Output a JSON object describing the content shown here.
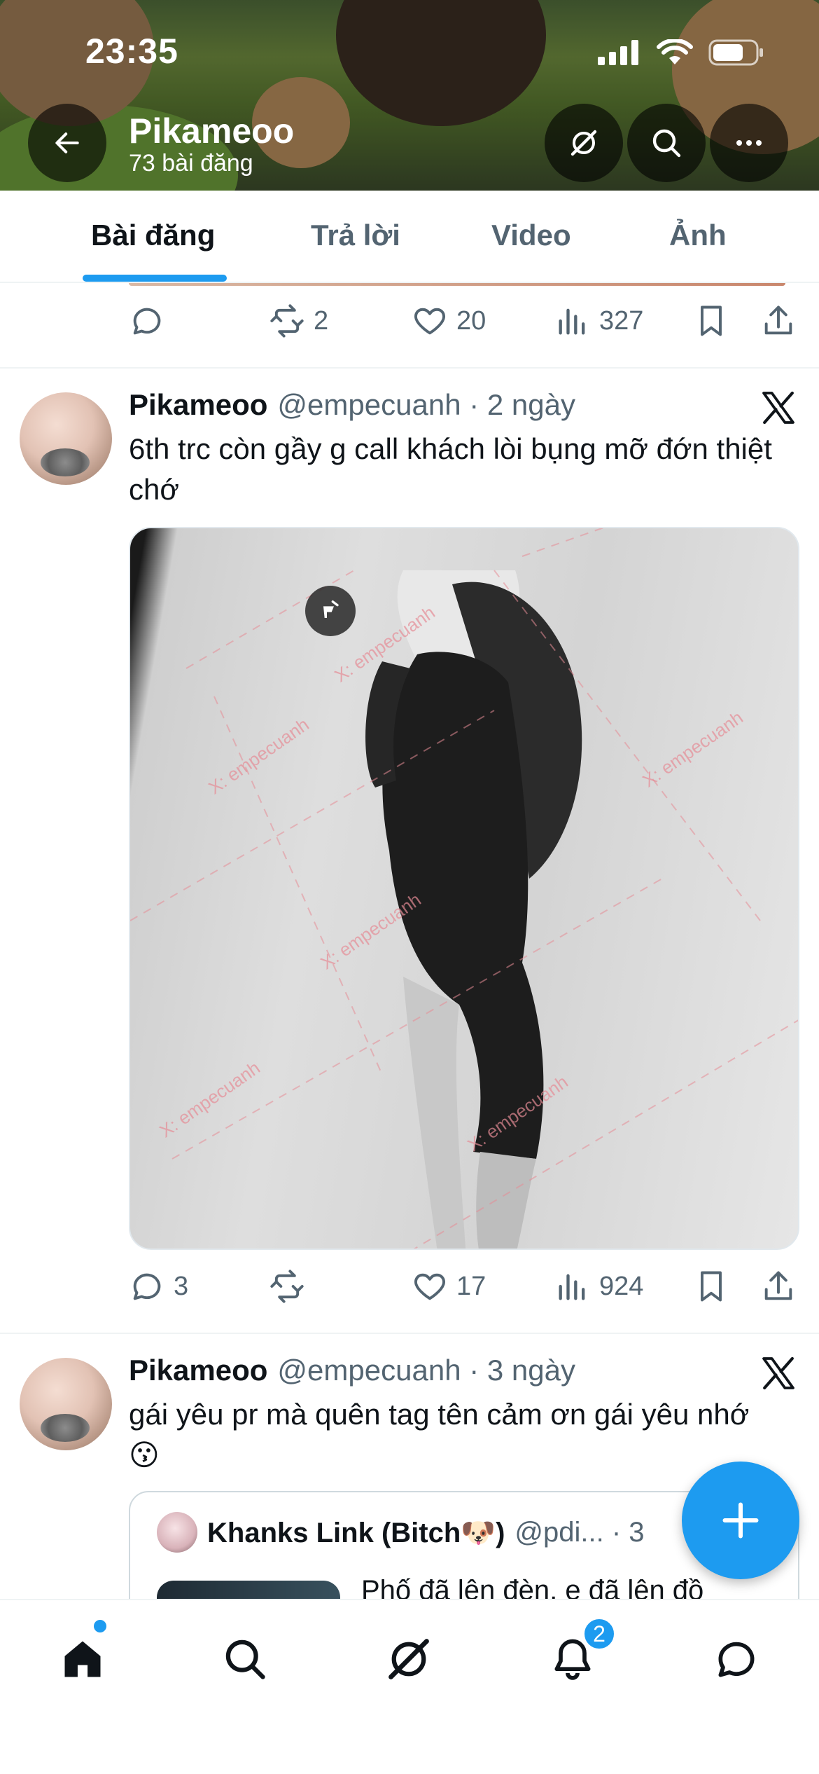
{
  "status_bar": {
    "time": "23:35"
  },
  "profile_header": {
    "name": "Pikameoo",
    "post_count": "73 bài đăng"
  },
  "tabs": [
    {
      "label": "Bài đăng",
      "active": true
    },
    {
      "label": "Trả lời",
      "active": false
    },
    {
      "label": "Video",
      "active": false
    },
    {
      "label": "Ảnh",
      "active": false
    }
  ],
  "post0_actions": {
    "replies": "",
    "reposts": "2",
    "likes": "20",
    "views": "327"
  },
  "posts": [
    {
      "name": "Pikameoo",
      "meta": "@empecuanh · 2 ngày",
      "text": "6th trc còn gầy g call khách lòi bụng mỡ đớn thiệt chớ",
      "actions": {
        "replies": "3",
        "reposts": "",
        "likes": "17",
        "views": "924"
      }
    },
    {
      "name": "Pikameoo",
      "meta": "@empecuanh · 3 ngày",
      "text": "gái yêu pr mà quên tag tên cảm ơn gái yêu nhớ 😗",
      "quote": {
        "name": "Khanks Link (Bitch🐶)",
        "meta": "@pdi... · 3",
        "text": "Phố đã lên đèn, e đã lên đồ"
      }
    }
  ],
  "notifications_badge": "2",
  "colors": {
    "accent": "#1d9bf0",
    "text": "#0f1419",
    "secondary": "#536471"
  }
}
